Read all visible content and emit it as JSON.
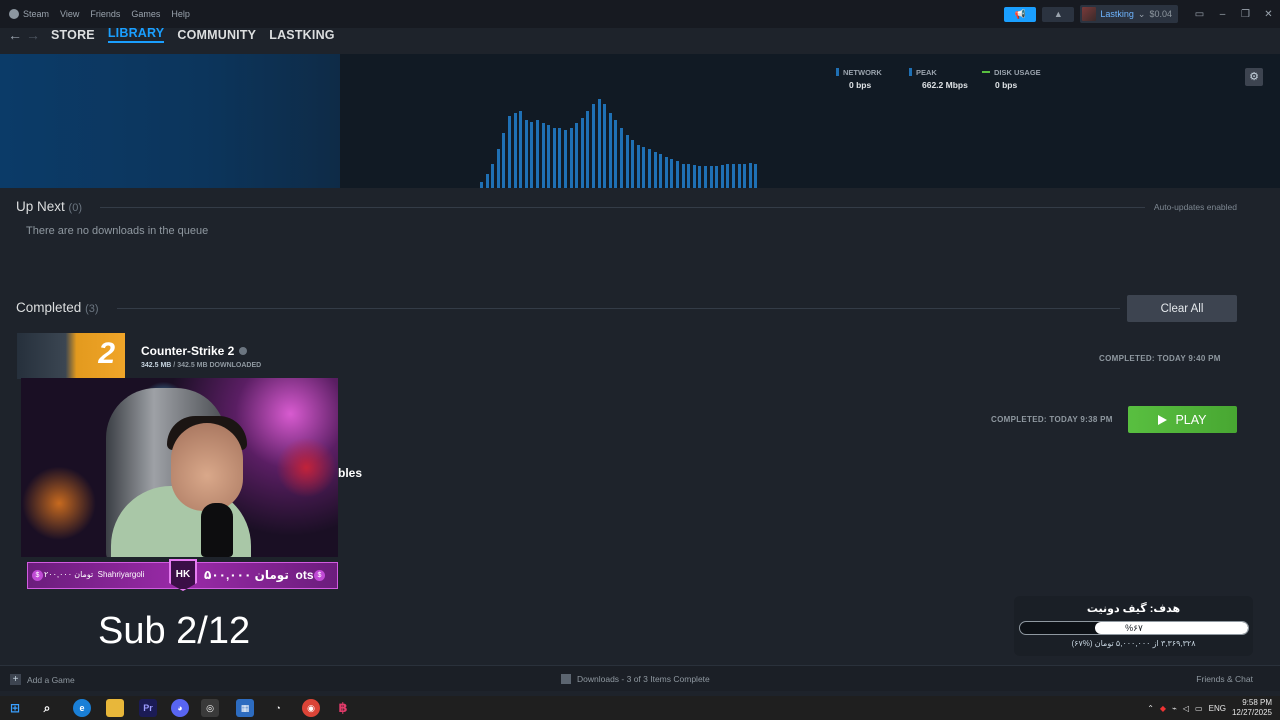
{
  "titlebar": {
    "menu": [
      "Steam",
      "View",
      "Friends",
      "Games",
      "Help"
    ],
    "username": "Lastking",
    "wallet": "$0.04"
  },
  "nav": {
    "links": [
      "STORE",
      "LIBRARY",
      "COMMUNITY",
      "LASTKING"
    ],
    "active": "LIBRARY"
  },
  "graph": {
    "network_label": "NETWORK",
    "network_value": "0 bps",
    "peak_label": "PEAK",
    "peak_value": "662.2 Mbps",
    "disk_label": "DISK USAGE",
    "disk_value": "0 bps",
    "bar_levels": [
      0.05,
      0.12,
      0.2,
      0.32,
      0.46,
      0.6,
      0.62,
      0.64,
      0.56,
      0.55,
      0.56,
      0.54,
      0.52,
      0.5,
      0.5,
      0.48,
      0.5,
      0.54,
      0.58,
      0.64,
      0.7,
      0.74,
      0.7,
      0.62,
      0.56,
      0.5,
      0.44,
      0.4,
      0.36,
      0.34,
      0.32,
      0.3,
      0.28,
      0.26,
      0.24,
      0.22,
      0.2,
      0.2,
      0.19,
      0.18,
      0.18,
      0.18,
      0.18,
      0.19,
      0.2,
      0.2,
      0.2,
      0.2,
      0.21,
      0.2
    ],
    "bar_color": "#1f70b4"
  },
  "up_next": {
    "title": "Up Next",
    "count": "(0)",
    "auto_updates": "Auto-updates enabled",
    "empty_text": "There are no downloads in the queue"
  },
  "completed": {
    "title": "Completed",
    "count": "(3)",
    "clear_all": "Clear All",
    "items": [
      {
        "title": "Counter-Strike 2",
        "size": "342.5 MB",
        "downloaded": "342.5 MB DOWNLOADED",
        "completed_at": "COMPLETED: TODAY 9:40 PM",
        "thumb_text": "2"
      },
      {
        "completed_at": "COMPLETED: TODAY 9:38 PM",
        "play_label": "PLAY"
      },
      {
        "title_fragment": "bles"
      }
    ]
  },
  "stream_overlay": {
    "donor_left": "Shahriyargoli",
    "donor_left_amount": "۲۰۰,۰۰۰ تومان",
    "badge": "HK",
    "donor_right_amount": "۵۰۰,۰۰۰ تومان",
    "donor_right": "ots",
    "sub_text": "Sub 2/12"
  },
  "goal": {
    "title": "هدف: گیف دونیت",
    "percent_text": "%۶۷",
    "percent": 0.67,
    "subtitle": "۳,۳۶۹,۳۲۸ از ۵,۰۰۰,۰۰۰ تومان (%۶۷)"
  },
  "footer": {
    "add_game": "Add a Game",
    "downloads": "Downloads - 3 of 3 Items Complete",
    "friends_chat": "Friends & Chat"
  },
  "taskbar": {
    "lang": "ENG",
    "time": "9:58 PM",
    "date": "12/27/2025"
  }
}
